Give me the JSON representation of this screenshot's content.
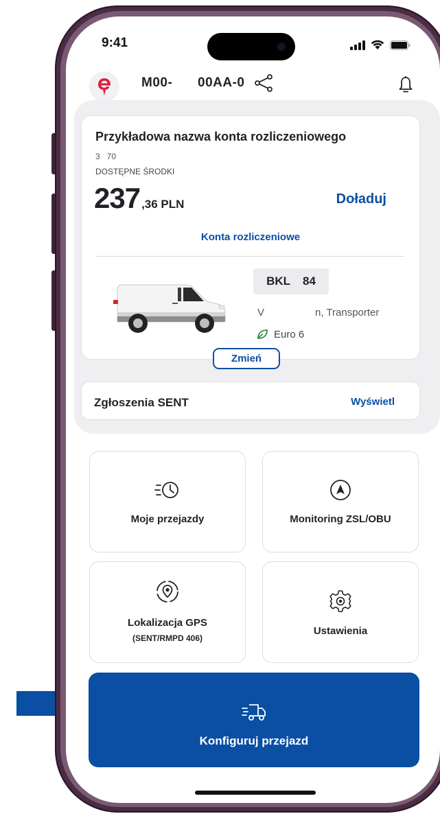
{
  "status": {
    "time": "9:41"
  },
  "header": {
    "plate_left": "M00-",
    "plate_right": "00AA-0"
  },
  "account": {
    "name": "Przykładowa nazwa konta rozliczeniowego",
    "number": "3   70",
    "balance_caption": "DOSTĘPNE ŚRODKI",
    "balance_integer": "237",
    "balance_decimal": ",36 PLN",
    "topup_label": "Doładuj",
    "accounts_link": "Konta rozliczeniowe"
  },
  "vehicle": {
    "plate_part1": "BKL",
    "plate_part2": "84",
    "model_part1": "V",
    "model_part2": "n, Transporter",
    "emission": "Euro 6",
    "change_label": "Zmień"
  },
  "sent": {
    "label": "Zgłoszenia SENT",
    "link": "Wyświetl"
  },
  "tiles": [
    {
      "label": "Moje przejazdy",
      "icon": "history-clock-icon"
    },
    {
      "label": "Monitoring ZSL/OBU",
      "icon": "navigation-arrow-icon"
    },
    {
      "label": "Lokalizacja GPS",
      "sub": "(SENT/RMPD 406)",
      "icon": "gps-location-icon"
    },
    {
      "label": "Ustawienia",
      "icon": "gear-icon"
    }
  ],
  "cta": {
    "label": "Konfiguruj przejazd",
    "icon": "moving-truck-icon"
  },
  "colors": {
    "primary": "#0a4fa3",
    "logo_red": "#d9233a",
    "frame": "#4a2c45",
    "leaf_green": "#2e8b3a"
  }
}
